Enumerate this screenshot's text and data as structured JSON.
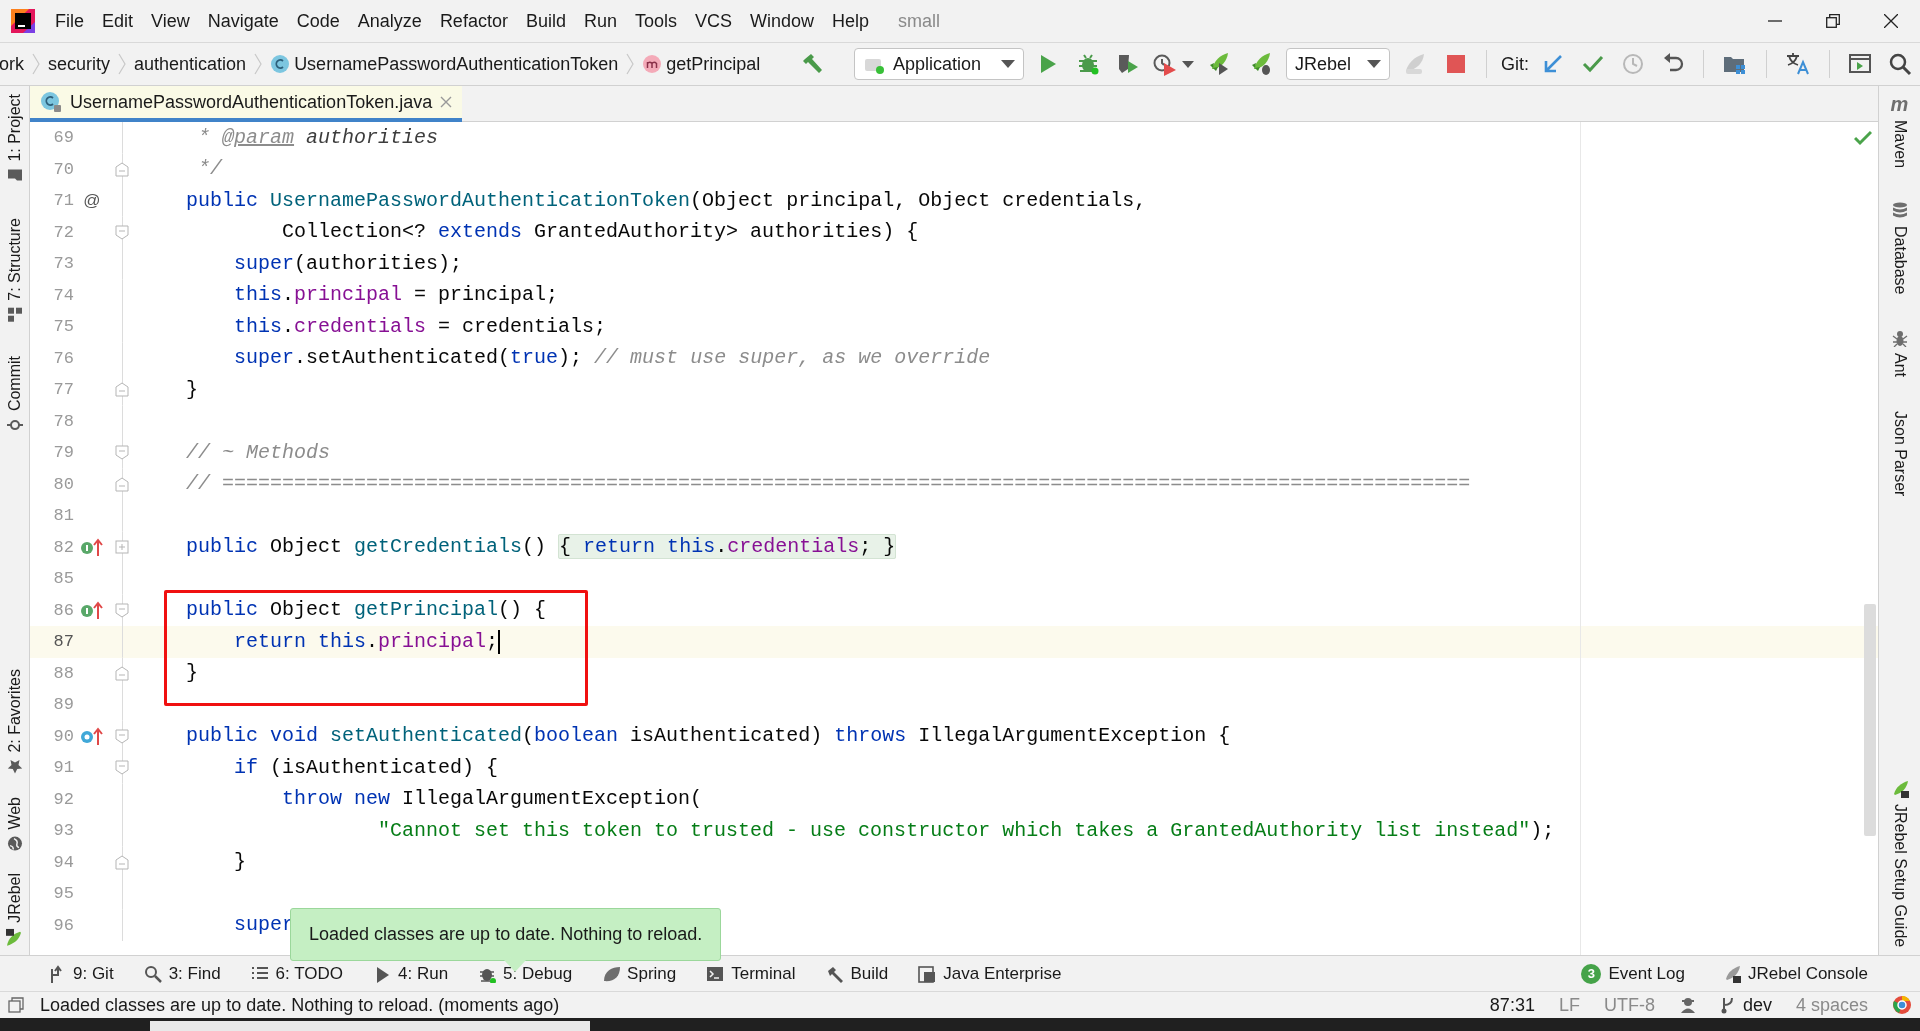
{
  "menu": [
    "File",
    "Edit",
    "View",
    "Navigate",
    "Code",
    "Analyze",
    "Refactor",
    "Build",
    "Run",
    "Tools",
    "VCS",
    "Window",
    "Help"
  ],
  "project_title": "small",
  "breadcrumbs": [
    {
      "text": "ork",
      "kind": "folder"
    },
    {
      "text": "security",
      "kind": "folder"
    },
    {
      "text": "authentication",
      "kind": "folder"
    },
    {
      "text": "UsernamePasswordAuthenticationToken",
      "kind": "class"
    },
    {
      "text": "getPrincipal",
      "kind": "method"
    }
  ],
  "run_config": {
    "label": "Application"
  },
  "jrebel_config": {
    "label": "JRebel"
  },
  "git_label": "Git:",
  "tabs": [
    {
      "label": "UsernamePasswordAuthenticationToken.java",
      "selected": true
    }
  ],
  "left_tool_windows": {
    "top": [
      {
        "label": "1: Project",
        "kind": "project"
      },
      {
        "label": "7: Structure",
        "kind": "structure"
      },
      {
        "label": "Commit",
        "kind": "commit"
      }
    ],
    "bottom": [
      {
        "label": "2: Favorites",
        "kind": "favorites"
      },
      {
        "label": "Web",
        "kind": "web"
      },
      {
        "label": "JRebel",
        "kind": "jrebel"
      }
    ]
  },
  "right_tool_windows": {
    "top": [
      {
        "label": "Maven",
        "kind": "maven",
        "icon_text": "m"
      },
      {
        "label": "Database",
        "kind": "database"
      },
      {
        "label": "Ant",
        "kind": "ant"
      },
      {
        "label": "Json Parser",
        "kind": "none"
      }
    ],
    "bottom": [
      {
        "label": "JRebel Setup Guide",
        "kind": "jrebel"
      }
    ]
  },
  "editor": {
    "sections": [
      {
        "kind": "plain",
        "lines": [
          {
            "number": "69",
            "current": false,
            "tokens": [
              {
                "kind": "comment",
                "text": "     * "
              },
              {
                "kind": "doctag",
                "text": "@param"
              },
              {
                "kind": "docparam",
                "text": " authorities"
              }
            ]
          },
          {
            "number": "70",
            "current": false,
            "fold": {
              "kind": "end"
            },
            "tokens": [
              {
                "kind": "comment",
                "text": "     */"
              }
            ]
          },
          {
            "number": "71",
            "current": false,
            "gutter_text": "@",
            "tokens": [
              {
                "kind": "kw",
                "text": "    public"
              },
              {
                "kind": "decl",
                "text": " UsernamePasswordAuthenticationToken"
              },
              {
                "kind": "plain",
                "text": "(Object principal, Object credentials,"
              }
            ]
          },
          {
            "number": "72",
            "current": false,
            "fold": {
              "kind": "start"
            },
            "tokens": [
              {
                "kind": "plain",
                "text": "            Collection<? "
              },
              {
                "kind": "kw",
                "text": "extends"
              },
              {
                "kind": "plain",
                "text": " GrantedAuthority> authorities) {"
              }
            ]
          },
          {
            "number": "73",
            "current": false,
            "tokens": [
              {
                "kind": "kw",
                "text": "        super"
              },
              {
                "kind": "plain",
                "text": "(authorities);"
              }
            ]
          },
          {
            "number": "74",
            "current": false,
            "tokens": [
              {
                "kind": "kw",
                "text": "        this"
              },
              {
                "kind": "plain",
                "text": "."
              },
              {
                "kind": "field",
                "text": "principal"
              },
              {
                "kind": "plain",
                "text": " = principal;"
              }
            ]
          },
          {
            "number": "75",
            "current": false,
            "tokens": [
              {
                "kind": "kw",
                "text": "        this"
              },
              {
                "kind": "plain",
                "text": "."
              },
              {
                "kind": "field",
                "text": "credentials"
              },
              {
                "kind": "plain",
                "text": " = credentials;"
              }
            ]
          },
          {
            "number": "76",
            "current": false,
            "tokens": [
              {
                "kind": "kw",
                "text": "        super"
              },
              {
                "kind": "plain",
                "text": ".setAuthenticated("
              },
              {
                "kind": "kw",
                "text": "true"
              },
              {
                "kind": "plain",
                "text": "); "
              },
              {
                "kind": "comment",
                "text": "// must use super, as we override"
              }
            ]
          },
          {
            "number": "77",
            "current": false,
            "fold": {
              "kind": "end"
            },
            "tokens": [
              {
                "kind": "plain",
                "text": "    }"
              }
            ]
          },
          {
            "number": "78",
            "current": false
          },
          {
            "number": "79",
            "current": false,
            "fold": {
              "kind": "start"
            },
            "tokens": [
              {
                "kind": "comment",
                "text": "    // ~ Methods"
              }
            ]
          },
          {
            "number": "80",
            "current": false,
            "fold": {
              "kind": "end"
            },
            "tokens": [
              {
                "kind": "comment",
                "text": "    // ========================================================================================================"
              }
            ]
          },
          {
            "number": "81",
            "current": false
          },
          {
            "number": "82",
            "current": false,
            "marker": {
              "kind": "implements"
            },
            "fold": {
              "kind": "collapsed"
            },
            "tokens": [
              {
                "kind": "kw",
                "text": "    public"
              },
              {
                "kind": "plain",
                "text": " Object "
              },
              {
                "kind": "decl",
                "text": "getCredentials"
              },
              {
                "kind": "plain",
                "text": "() "
              }
            ],
            "folded_tokens": [
              {
                "kind": "plain",
                "text": "{ "
              },
              {
                "kind": "kw",
                "text": "return this"
              },
              {
                "kind": "plain",
                "text": "."
              },
              {
                "kind": "field",
                "text": "credentials"
              },
              {
                "kind": "plain",
                "text": "; }"
              }
            ]
          },
          {
            "number": "85",
            "current": false
          }
        ]
      },
      {
        "kind": "annotated",
        "lines": [
          {
            "number": "86",
            "current": false,
            "marker": {
              "kind": "implements"
            },
            "fold": {
              "kind": "start"
            },
            "tokens": [
              {
                "kind": "kw",
                "text": "    public"
              },
              {
                "kind": "plain",
                "text": " Object "
              },
              {
                "kind": "decl",
                "text": "getPrincipal"
              },
              {
                "kind": "plain",
                "text": "() {"
              }
            ]
          },
          {
            "number": "87",
            "current": true,
            "tokens": [
              {
                "kind": "kw",
                "text": "        return this"
              },
              {
                "kind": "plain",
                "text": "."
              },
              {
                "kind": "field",
                "text": "principal"
              },
              {
                "kind": "plain",
                "text": ";"
              }
            ]
          },
          {
            "number": "88",
            "current": false,
            "fold": {
              "kind": "end"
            },
            "tokens": [
              {
                "kind": "plain",
                "text": "    }"
              }
            ]
          }
        ]
      },
      {
        "kind": "plain",
        "lines": [
          {
            "number": "89",
            "current": false
          },
          {
            "number": "90",
            "current": false,
            "marker": {
              "kind": "overrides"
            },
            "fold": {
              "kind": "start"
            },
            "tokens": [
              {
                "kind": "kw",
                "text": "    public void"
              },
              {
                "kind": "decl",
                "text": " setAuthenticated"
              },
              {
                "kind": "plain",
                "text": "("
              },
              {
                "kind": "kw",
                "text": "boolean"
              },
              {
                "kind": "plain",
                "text": " isAuthenticated) "
              },
              {
                "kind": "kw",
                "text": "throws"
              },
              {
                "kind": "plain",
                "text": " IllegalArgumentException {"
              }
            ]
          },
          {
            "number": "91",
            "current": false,
            "fold": {
              "kind": "start"
            },
            "tokens": [
              {
                "kind": "kw",
                "text": "        if"
              },
              {
                "kind": "plain",
                "text": " (isAuthenticated) {"
              }
            ]
          },
          {
            "number": "92",
            "current": false,
            "tokens": [
              {
                "kind": "kw",
                "text": "            throw new"
              },
              {
                "kind": "plain",
                "text": " IllegalArgumentException("
              }
            ]
          },
          {
            "number": "93",
            "current": false,
            "tokens": [
              {
                "kind": "string",
                "text": "                    \"Cannot set this token to trusted - use constructor which takes a GrantedAuthority list instead\""
              },
              {
                "kind": "plain",
                "text": ");"
              }
            ]
          },
          {
            "number": "94",
            "current": false,
            "fold": {
              "kind": "end"
            },
            "tokens": [
              {
                "kind": "plain",
                "text": "        }"
              }
            ]
          },
          {
            "number": "95",
            "current": false
          },
          {
            "number": "96",
            "current": false,
            "tokens": [
              {
                "kind": "kw",
                "text": "        super"
              }
            ]
          }
        ]
      }
    ]
  },
  "toast": "Loaded classes are up to date. Nothing to reload.",
  "bottom_tools": [
    {
      "label": "9: Git",
      "kind": "git"
    },
    {
      "label": "3: Find",
      "kind": "find"
    },
    {
      "label": "6: TODO",
      "kind": "todo"
    },
    {
      "label": "4: Run",
      "kind": "run"
    },
    {
      "label": "5: Debug",
      "kind": "debug"
    },
    {
      "label": "Spring",
      "kind": "spring"
    },
    {
      "label": "Terminal",
      "kind": "terminal"
    },
    {
      "label": "Build",
      "kind": "build"
    },
    {
      "label": "Java Enterprise",
      "kind": "javaee"
    }
  ],
  "event_log": {
    "label": "Event Log",
    "count": "3"
  },
  "jrebel_console": {
    "label": "JRebel Console"
  },
  "status_bar": {
    "message": "Loaded classes are up to date. Nothing to reload. (moments ago)",
    "position": "87:31",
    "line_separator": "LF",
    "encoding": "UTF-8",
    "branch": "dev",
    "indent": "4 spaces"
  }
}
